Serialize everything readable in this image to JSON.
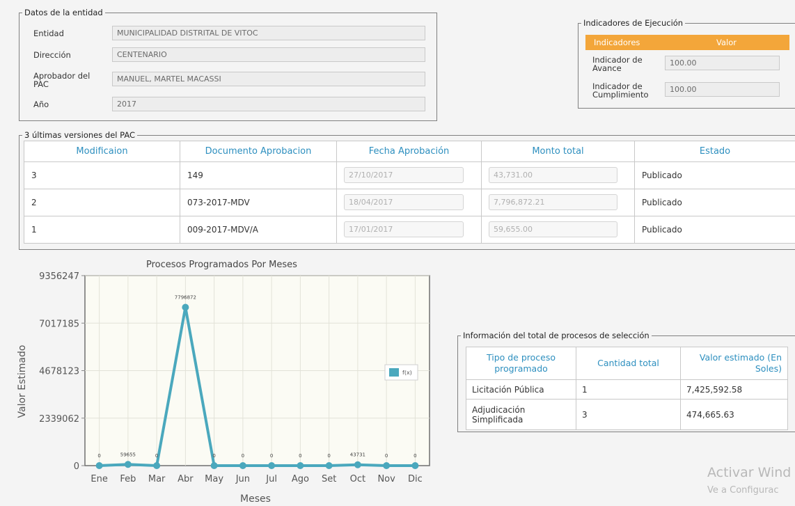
{
  "entidad": {
    "legend": "Datos de la entidad",
    "fields": [
      {
        "label": "Entidad",
        "value": "MUNICIPALIDAD DISTRITAL DE VITOC"
      },
      {
        "label": "Dirección",
        "value": "CENTENARIO"
      },
      {
        "label": "Aprobador del PAC",
        "value": "MANUEL, MARTEL MACASSI"
      },
      {
        "label": "Año",
        "value": "2017"
      }
    ]
  },
  "indicadores": {
    "legend": "Indicadores de Ejecución",
    "col_indicadores": "Indicadores",
    "col_valor": "Valor",
    "rows": [
      {
        "label": "Indicador de Avance",
        "value": "100.00"
      },
      {
        "label": "Indicador de Cumplimiento",
        "value": "100.00"
      }
    ]
  },
  "versiones": {
    "legend": "3 últimas versiones del PAC",
    "headers": [
      "Modificaion",
      "Documento Aprobacion",
      "Fecha Aprobación",
      "Monto total",
      "Estado"
    ],
    "rows": [
      {
        "mod": "3",
        "doc": "149",
        "fecha": "27/10/2017",
        "monto": "43,731.00",
        "estado": "Publicado"
      },
      {
        "mod": "2",
        "doc": "073-2017-MDV",
        "fecha": "18/04/2017",
        "monto": "7,796,872.21",
        "estado": "Publicado"
      },
      {
        "mod": "1",
        "doc": "009-2017-MDV/A",
        "fecha": "17/01/2017",
        "monto": "59,655.00",
        "estado": "Publicado"
      }
    ]
  },
  "chart_data": {
    "type": "line",
    "title": "Procesos Programados Por Meses",
    "xlabel": "Meses",
    "ylabel": "Valor Estimado",
    "categories": [
      "Ene",
      "Feb",
      "Mar",
      "Abr",
      "May",
      "Jun",
      "Jul",
      "Ago",
      "Set",
      "Oct",
      "Nov",
      "Dic"
    ],
    "series": [
      {
        "name": "f(x)",
        "values": [
          0,
          59655,
          0,
          7796872,
          0,
          0,
          0,
          0,
          0,
          43731,
          0,
          0
        ],
        "color": "#4aa8bd"
      }
    ],
    "y_ticks": [
      "0",
      "2339062",
      "4678123",
      "7017185",
      "9356247"
    ],
    "ylim": [
      0,
      9356247
    ],
    "grid": true,
    "legend_position": "right"
  },
  "info_procesos": {
    "legend": "Información del total de procesos de selección",
    "headers": [
      "Tipo de proceso programado",
      "Cantidad total",
      "Valor estimado (En Soles)"
    ],
    "rows": [
      {
        "tipo": "Licitación Pública",
        "cantidad": "1",
        "valor": "7,425,592.58"
      },
      {
        "tipo": "Adjudicación Simplificada",
        "cantidad": "3",
        "valor": "474,665.63"
      }
    ]
  },
  "watermark": {
    "line1": "Activar Wind",
    "line2": "Ve a Configurac"
  },
  "colors": {
    "accent": "#f3a63a",
    "header_text": "#2d8fbf",
    "series": "#4aa8bd"
  }
}
